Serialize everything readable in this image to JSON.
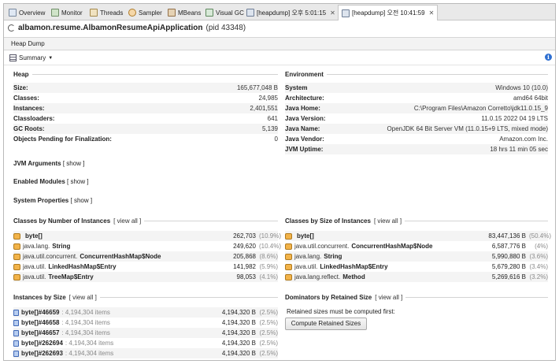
{
  "tabs": [
    {
      "label": "Overview",
      "icon": "overview-icon"
    },
    {
      "label": "Monitor",
      "icon": "monitor-icon"
    },
    {
      "label": "Threads",
      "icon": "threads-icon"
    },
    {
      "label": "Sampler",
      "icon": "sampler-icon"
    },
    {
      "label": "MBeans",
      "icon": "mbeans-icon"
    },
    {
      "label": "Visual GC",
      "icon": "visualgc-icon"
    },
    {
      "label": "[heapdump] 오후 5:01:15",
      "icon": "heapdump-icon",
      "close": "✕"
    },
    {
      "label": "[heapdump] 오전 10:41:59",
      "icon": "heapdump-icon",
      "close": "✕",
      "active": true
    }
  ],
  "app": {
    "name": "albamon.resume.AlbamonResumeApiApplication",
    "pid": "(pid 43348)"
  },
  "toolbar": {
    "label": "Heap Dump"
  },
  "summary": {
    "label": "Summary",
    "caret": "▼",
    "info": "i"
  },
  "heap": {
    "title": "Heap",
    "rows": [
      {
        "k": "Size:",
        "v": "165,677,048 B"
      },
      {
        "k": "Classes:",
        "v": "24,985"
      },
      {
        "k": "Instances:",
        "v": "2,401,551"
      },
      {
        "k": "Classloaders:",
        "v": "641"
      },
      {
        "k": "GC Roots:",
        "v": "5,139"
      },
      {
        "k": "Objects Pending for Finalization:",
        "v": "0"
      }
    ]
  },
  "environment": {
    "title": "Environment",
    "rows": [
      {
        "k": "System",
        "v": "Windows 10 (10.0)"
      },
      {
        "k": "Architecture:",
        "v": "amd64 64bit"
      },
      {
        "k": "Java Home:",
        "v": "C:\\Program Files\\Amazon Corretto\\jdk11.0.15_9"
      },
      {
        "k": "Java Version:",
        "v": "11.0.15 2022 04 19 LTS"
      },
      {
        "k": "Java Name:",
        "v": "OpenJDK 64 Bit Server VM (11.0.15+9 LTS, mixed mode)"
      },
      {
        "k": "Java Vendor:",
        "v": "Amazon.com Inc."
      },
      {
        "k": "JVM Uptime:",
        "v": "18 hrs 11 min 05 sec"
      }
    ]
  },
  "jvm_args": {
    "label": "JVM Arguments",
    "link": "[ show ]"
  },
  "enabled_modules": {
    "label": "Enabled Modules",
    "link": "[ show ]"
  },
  "system_props": {
    "label": "System Properties",
    "link": "[ show ]"
  },
  "classes_by_instances": {
    "title": "Classes by Number of Instances",
    "link": "[ view all ]",
    "rows": [
      {
        "pkg": "",
        "name": "byte[]",
        "num": "262,703",
        "pct": "(10.9%)"
      },
      {
        "pkg": "java.lang.",
        "name": "String",
        "num": "249,620",
        "pct": "(10.4%)"
      },
      {
        "pkg": "java.util.concurrent.",
        "name": "ConcurrentHashMap$Node",
        "num": "205,868",
        "pct": "(8.6%)"
      },
      {
        "pkg": "java.util.",
        "name": "LinkedHashMap$Entry",
        "num": "141,982",
        "pct": "(5.9%)"
      },
      {
        "pkg": "java.util.",
        "name": "TreeMap$Entry",
        "num": "98,053",
        "pct": "(4.1%)"
      }
    ]
  },
  "classes_by_size": {
    "title": "Classes by Size of Instances",
    "link": "[ view all ]",
    "rows": [
      {
        "pkg": "",
        "name": "byte[]",
        "num": "83,447,136 B",
        "pct": "(50.4%)"
      },
      {
        "pkg": "java.util.concurrent.",
        "name": "ConcurrentHashMap$Node",
        "num": "6,587,776 B",
        "pct": "(4%)"
      },
      {
        "pkg": "java.lang.",
        "name": "String",
        "num": "5,990,880 B",
        "pct": "(3.6%)"
      },
      {
        "pkg": "java.util.",
        "name": "LinkedHashMap$Entry",
        "num": "5,679,280 B",
        "pct": "(3.4%)"
      },
      {
        "pkg": "java.lang.reflect.",
        "name": "Method",
        "num": "5,269,616 B",
        "pct": "(3.2%)"
      }
    ]
  },
  "instances_by_size": {
    "title": "Instances by Size",
    "link": "[ view all ]",
    "rows": [
      {
        "name": "byte[]#46659",
        "items": ": 4,194,304 items",
        "num": "4,194,320 B",
        "pct": "(2.5%)"
      },
      {
        "name": "byte[]#46658",
        "items": ": 4,194,304 items",
        "num": "4,194,320 B",
        "pct": "(2.5%)"
      },
      {
        "name": "byte[]#46657",
        "items": ": 4,194,304 items",
        "num": "4,194,320 B",
        "pct": "(2.5%)"
      },
      {
        "name": "byte[]#262694",
        "items": ": 4,194,304 items",
        "num": "4,194,320 B",
        "pct": "(2.5%)"
      },
      {
        "name": "byte[]#262693",
        "items": ": 4,194,304 items",
        "num": "4,194,320 B",
        "pct": "(2.5%)"
      }
    ]
  },
  "dominators": {
    "title": "Dominators by Retained Size",
    "link": "[ view all ]",
    "message": "Retained sizes must be computed first:",
    "button": "Compute Retained Sizes"
  }
}
